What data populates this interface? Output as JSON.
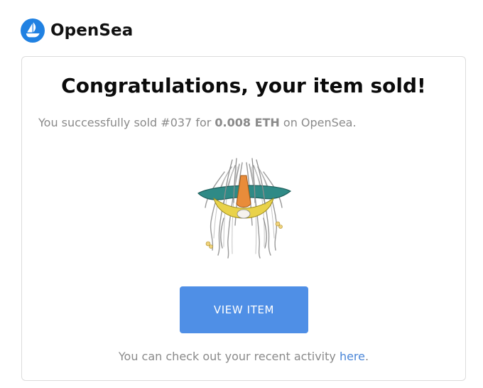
{
  "brand": {
    "name": "OpenSea",
    "logo_icon": "opensea-boat-logo",
    "logo_color": "#2081e2"
  },
  "email": {
    "headline": "Congratulations, your item sold!",
    "sold_prefix": "You successfully sold #037 for ",
    "sold_price": "0.008 ETH",
    "sold_suffix": " on OpenSea.",
    "item_image": "nft-artwork-long-haired-figure-with-teal-hat",
    "view_button_label": "VIEW ITEM",
    "view_button_color": "#4f8fe6",
    "activity_prefix": "You can check out your recent activity ",
    "activity_link": "here",
    "activity_suffix": ".",
    "link_color": "#4a86d8"
  }
}
